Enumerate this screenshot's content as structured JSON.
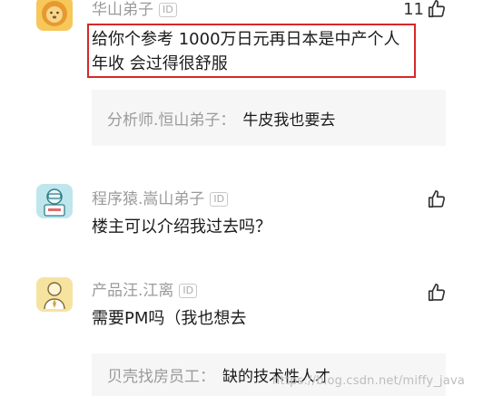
{
  "comments": [
    {
      "username": "华山弟子",
      "id_badge": "ID",
      "like_count": "11",
      "text_line1": "给你个参考 1000万日元再日本是中产个人",
      "text_line2": "年收 会过得很舒服",
      "reply": {
        "username": "分析师.恒山弟子",
        "separator": "：",
        "text": "牛皮我也要去"
      }
    },
    {
      "username": "程序猿.嵩山弟子",
      "id_badge": "ID",
      "text": "楼主可以介绍我过去吗？"
    },
    {
      "username": "产品汪.江离",
      "id_badge": "ID",
      "text": "需要PM吗（我也想去",
      "reply": {
        "username": "贝壳找房员工",
        "separator": "：",
        "text": "缺的技术性人才"
      }
    }
  ],
  "watermark": "https://blog.csdn.net/miffy_java",
  "colors": {
    "highlight_border": "#d62828",
    "reply_bg": "#f6f6f6",
    "muted_text": "#9a9a9a"
  }
}
